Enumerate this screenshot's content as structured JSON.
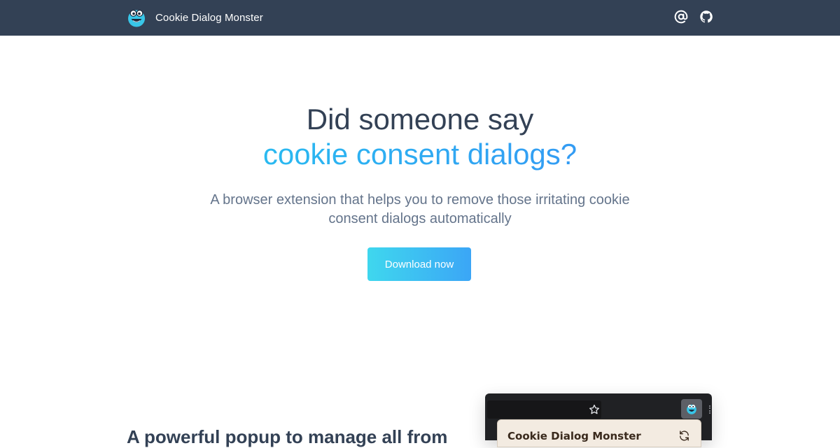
{
  "header": {
    "brand_name": "Cookie Dialog Monster",
    "icons": [
      "monster-logo",
      "at-sign-icon",
      "github-icon"
    ]
  },
  "hero": {
    "title_line1": "Did someone say",
    "title_line2": "cookie consent dialogs?",
    "subtitle": "A browser extension that helps you to remove those irritating cookie consent dialogs automatically",
    "cta_label": "Download now"
  },
  "feature": {
    "heading": "A powerful popup to manage all from"
  },
  "mock_browser": {
    "popup_title": "Cookie Dialog Monster",
    "icons": [
      "star-icon",
      "monster-extension-icon",
      "refresh-icon"
    ]
  },
  "colors": {
    "header_bg": "#334155",
    "title": "#334155",
    "accent_start": "#22d3ee",
    "accent_end": "#3b82f6",
    "subtitle": "#64748b",
    "popup_bg": "#f3ebe1"
  }
}
